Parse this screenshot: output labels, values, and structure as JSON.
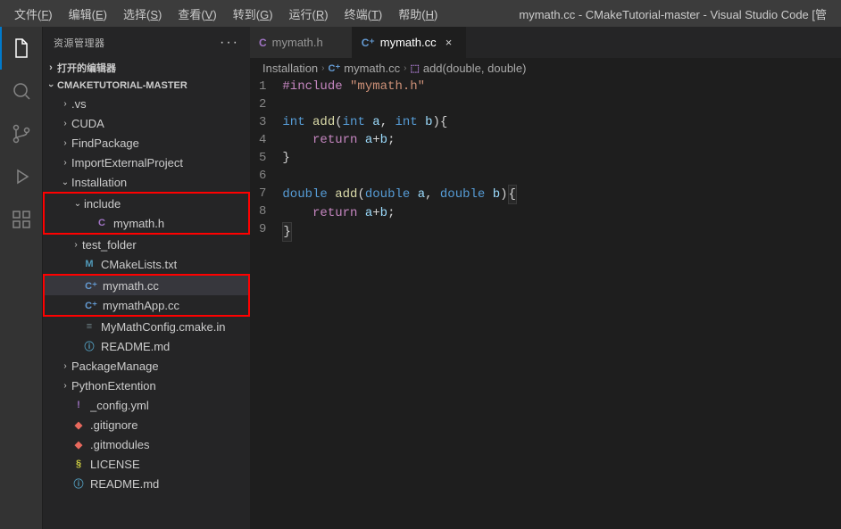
{
  "title": "mymath.cc - CMakeTutorial-master - Visual Studio Code [管",
  "menu": [
    {
      "label": "文件",
      "mn": "F"
    },
    {
      "label": "编辑",
      "mn": "E"
    },
    {
      "label": "选择",
      "mn": "S"
    },
    {
      "label": "查看",
      "mn": "V"
    },
    {
      "label": "转到",
      "mn": "G"
    },
    {
      "label": "运行",
      "mn": "R"
    },
    {
      "label": "终端",
      "mn": "T"
    },
    {
      "label": "帮助",
      "mn": "H"
    }
  ],
  "sidebar": {
    "title": "资源管理器",
    "more": "···",
    "openEditors": "打开的编辑器",
    "project": "CMAKETUTORIAL-MASTER"
  },
  "tree": [
    {
      "label": ".vs",
      "type": "folder",
      "chev": "right",
      "depth": 1
    },
    {
      "label": "CUDA",
      "type": "folder",
      "chev": "right",
      "depth": 1
    },
    {
      "label": "FindPackage",
      "type": "folder",
      "chev": "right",
      "depth": 1
    },
    {
      "label": "ImportExternalProject",
      "type": "folder",
      "chev": "right",
      "depth": 1
    },
    {
      "label": "Installation",
      "type": "folder",
      "chev": "down",
      "depth": 1
    },
    {
      "label": "include",
      "type": "folder",
      "chev": "down",
      "depth": 2,
      "hl": "red-top"
    },
    {
      "label": "mymath.h",
      "type": "file",
      "icon": "C",
      "iconCls": "ic-c",
      "depth": 3,
      "hl": "red-bot"
    },
    {
      "label": "test_folder",
      "type": "folder",
      "chev": "right",
      "depth": 2
    },
    {
      "label": "CMakeLists.txt",
      "type": "file",
      "icon": "M",
      "iconCls": "ic-m",
      "depth": 2
    },
    {
      "label": "mymath.cc",
      "type": "file",
      "icon": "C⁺",
      "iconCls": "ic-cpp",
      "depth": 2,
      "selected": true,
      "hl": "red-top"
    },
    {
      "label": "mymathApp.cc",
      "type": "file",
      "icon": "C⁺",
      "iconCls": "ic-cpp",
      "depth": 2,
      "hl": "red-bot"
    },
    {
      "label": "MyMathConfig.cmake.in",
      "type": "file",
      "icon": "≡",
      "iconCls": "ic-txt",
      "depth": 2
    },
    {
      "label": "README.md",
      "type": "file",
      "icon": "ⓘ",
      "iconCls": "ic-info",
      "depth": 2
    },
    {
      "label": "PackageManage",
      "type": "folder",
      "chev": "right",
      "depth": 1
    },
    {
      "label": "PythonExtention",
      "type": "folder",
      "chev": "right",
      "depth": 1
    },
    {
      "label": "_config.yml",
      "type": "file",
      "icon": "!",
      "iconCls": "ic-yml",
      "depth": 1
    },
    {
      "label": ".gitignore",
      "type": "file",
      "icon": "◆",
      "iconCls": "ic-git",
      "depth": 1
    },
    {
      "label": ".gitmodules",
      "type": "file",
      "icon": "◆",
      "iconCls": "ic-git",
      "depth": 1
    },
    {
      "label": "LICENSE",
      "type": "file",
      "icon": "§",
      "iconCls": "ic-lic",
      "depth": 1
    },
    {
      "label": "README.md",
      "type": "file",
      "icon": "ⓘ",
      "iconCls": "ic-info",
      "depth": 1
    }
  ],
  "tabs": [
    {
      "label": "mymath.h",
      "icon": "C",
      "iconCls": "ic-c",
      "active": false
    },
    {
      "label": "mymath.cc",
      "icon": "C⁺",
      "iconCls": "ic-cpp",
      "active": true
    }
  ],
  "breadcrumbs": [
    {
      "label": "Installation",
      "icon": "",
      "iconCls": ""
    },
    {
      "label": "mymath.cc",
      "icon": "C⁺",
      "iconCls": "ic-cpp"
    },
    {
      "label": "add(double, double)",
      "icon": "⬚",
      "iconCls": "bc-cube"
    }
  ],
  "code": {
    "lines": [
      "#include \"mymath.h\"",
      "",
      "int add(int a, int b){",
      "    return a+b;",
      "}",
      "",
      "double add(double a, double b){",
      "    return a+b;",
      "}"
    ],
    "tokens": [
      [
        {
          "t": "#include",
          "c": "tok-kw"
        },
        {
          "t": " ",
          "c": ""
        },
        {
          "t": "\"mymath.h\"",
          "c": "tok-str"
        }
      ],
      [],
      [
        {
          "t": "int",
          "c": "tok-type"
        },
        {
          "t": " ",
          "c": ""
        },
        {
          "t": "add",
          "c": "tok-fn"
        },
        {
          "t": "(",
          "c": "tok-pun"
        },
        {
          "t": "int",
          "c": "tok-type"
        },
        {
          "t": " ",
          "c": ""
        },
        {
          "t": "a",
          "c": "tok-param"
        },
        {
          "t": ", ",
          "c": "tok-pun"
        },
        {
          "t": "int",
          "c": "tok-type"
        },
        {
          "t": " ",
          "c": ""
        },
        {
          "t": "b",
          "c": "tok-param"
        },
        {
          "t": "){",
          "c": "tok-pun"
        }
      ],
      [
        {
          "t": "    ",
          "c": ""
        },
        {
          "t": "return",
          "c": "tok-kw"
        },
        {
          "t": " ",
          "c": ""
        },
        {
          "t": "a",
          "c": "tok-var"
        },
        {
          "t": "+",
          "c": "tok-pun"
        },
        {
          "t": "b",
          "c": "tok-var"
        },
        {
          "t": ";",
          "c": "tok-pun"
        }
      ],
      [
        {
          "t": "}",
          "c": "tok-pun"
        }
      ],
      [],
      [
        {
          "t": "double",
          "c": "tok-type"
        },
        {
          "t": " ",
          "c": ""
        },
        {
          "t": "add",
          "c": "tok-fn"
        },
        {
          "t": "(",
          "c": "tok-pun"
        },
        {
          "t": "double",
          "c": "tok-type"
        },
        {
          "t": " ",
          "c": ""
        },
        {
          "t": "a",
          "c": "tok-param"
        },
        {
          "t": ", ",
          "c": "tok-pun"
        },
        {
          "t": "double",
          "c": "tok-type"
        },
        {
          "t": " ",
          "c": ""
        },
        {
          "t": "b",
          "c": "tok-param"
        },
        {
          "t": ")",
          "c": "tok-pun"
        },
        {
          "t": "{",
          "c": "tok-pun",
          "hl": true
        }
      ],
      [
        {
          "t": "    ",
          "c": ""
        },
        {
          "t": "return",
          "c": "tok-kw"
        },
        {
          "t": " ",
          "c": ""
        },
        {
          "t": "a",
          "c": "tok-var"
        },
        {
          "t": "+",
          "c": "tok-pun"
        },
        {
          "t": "b",
          "c": "tok-var"
        },
        {
          "t": ";",
          "c": "tok-pun"
        }
      ],
      [
        {
          "t": "}",
          "c": "tok-pun",
          "hl": true
        }
      ]
    ]
  }
}
